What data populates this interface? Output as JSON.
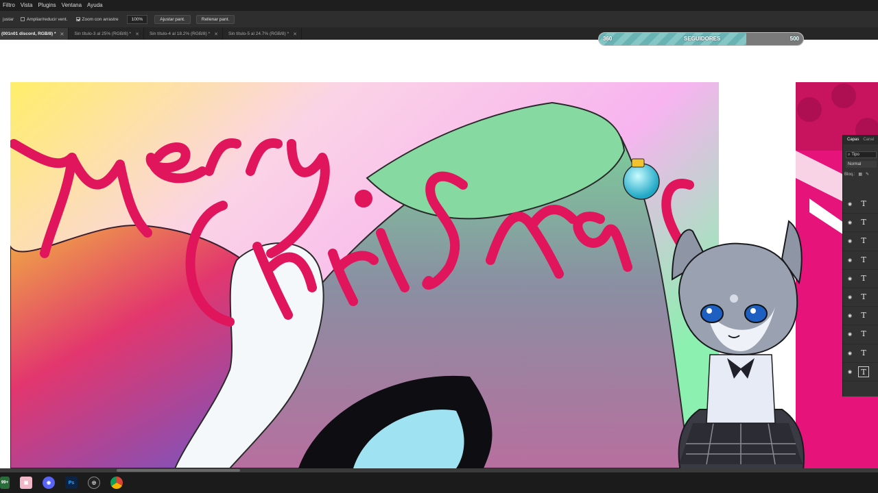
{
  "menubar": {
    "items": [
      "Filtro",
      "Vista",
      "Plugins",
      "Ventana",
      "Ayuda"
    ]
  },
  "options": {
    "cut_label": "justar",
    "resize_label": "Ampliar/reducir vent.",
    "resize_checked": false,
    "drag_zoom_label": "Zoom con arrastre",
    "drag_zoom_checked": true,
    "zoom_value": "100%",
    "fit_button": "Ajustar pant.",
    "fill_button": "Rellenar pant."
  },
  "tabs": [
    {
      "label": "(001n01 discord, RGB/8) *",
      "active": true
    },
    {
      "label": "Sin título-3 al 25% (RGB/8) *",
      "active": false
    },
    {
      "label": "Sin título-4 al 18.2% (RGB/8) *",
      "active": false
    },
    {
      "label": "Sin título-5 al 24.7% (RGB/8) *",
      "active": false
    }
  ],
  "followers": {
    "current": "360",
    "label": "SEGUIDORES",
    "goal": "500",
    "progress": 0.72
  },
  "layers_panel": {
    "tab_layers": "Capas",
    "tab_channels": "Canal",
    "filter_placeholder": "Tipo",
    "blend_mode": "Normal",
    "lock_label": "Bloq.:",
    "rows": [
      {
        "type": "T"
      },
      {
        "type": "T"
      },
      {
        "type": "T"
      },
      {
        "type": "T"
      },
      {
        "type": "T"
      },
      {
        "type": "T"
      },
      {
        "type": "T"
      },
      {
        "type": "T"
      },
      {
        "type": "T"
      },
      {
        "type": "T",
        "selected": true
      }
    ]
  },
  "taskbar": {
    "badge": "99+",
    "icons": [
      "app-badge-icon",
      "image-viewer-icon",
      "discord-icon",
      "photoshop-icon",
      "obs-icon",
      "chrome-icon"
    ]
  },
  "colors": {
    "lettering": "#e0155c",
    "accent_teal": "#6ab3b5",
    "side_panel_pink": "#e6137a"
  }
}
